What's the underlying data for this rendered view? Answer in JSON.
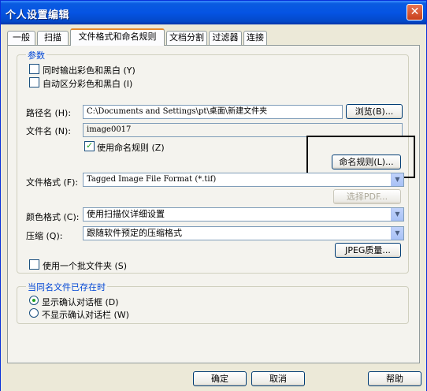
{
  "window": {
    "title": "个人设置编辑",
    "close_glyph": "✕"
  },
  "tabs": [
    {
      "label": "一般"
    },
    {
      "label": "扫描"
    },
    {
      "label": "文件格式和命名规则",
      "active": true
    },
    {
      "label": "文档分割"
    },
    {
      "label": "过滤器"
    },
    {
      "label": "连接"
    }
  ],
  "params": {
    "legend": "参数",
    "color_bw": {
      "label": "同时输出彩色和黑白 (Y)",
      "checked": false
    },
    "auto_color_bw": {
      "label": "自动区分彩色和黑白 (I)",
      "checked": false
    }
  },
  "path": {
    "label": "路径名 (H):",
    "value": "C:\\Documents and Settings\\pt\\桌面\\新建文件夹",
    "browse_label": "浏览(B)..."
  },
  "filename": {
    "label": "文件名 (N):",
    "value": "image0017"
  },
  "naming": {
    "checkbox_label": "使用命名规则 (Z)",
    "checked": true,
    "button_label": "命名规则(L)..."
  },
  "file_format": {
    "label": "文件格式 (F):",
    "value": "Tagged Image File Format (*.tif)",
    "pdf_button": "选择PDF..."
  },
  "color_format": {
    "label": "颜色格式 (C):",
    "value": "使用扫描仪详细设置"
  },
  "compression": {
    "label": "压缩 (Q):",
    "value": "跟随软件预定的压缩格式",
    "jpeg_button": "JPEG质量..."
  },
  "batch_folder": {
    "label": "使用一个批文件夹 (S)",
    "checked": false
  },
  "exists": {
    "legend": "当同名文件已存在时",
    "options": [
      {
        "label": "显示确认对话框 (D)",
        "selected": true
      },
      {
        "label": "不显示确认对话栏 (W)",
        "selected": false
      }
    ]
  },
  "footer": {
    "ok": "确定",
    "cancel": "取消",
    "help": "帮助"
  },
  "colors": {
    "title_bar": "#0554E3",
    "group_legend": "#0046D5",
    "active_tab_top": "#E68B2C"
  }
}
